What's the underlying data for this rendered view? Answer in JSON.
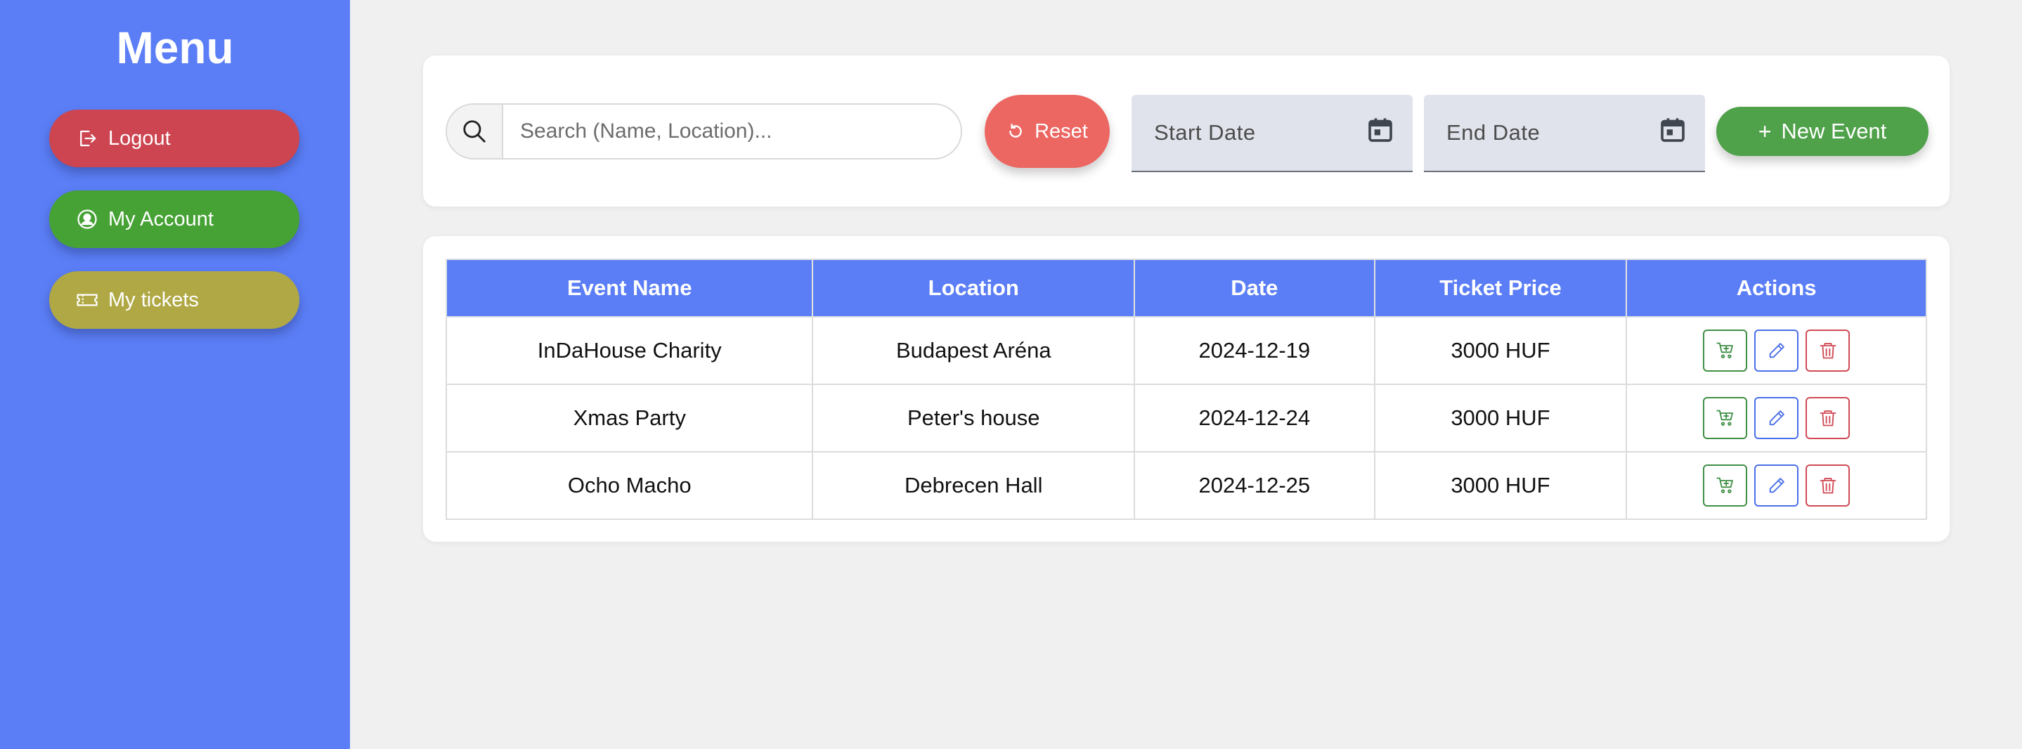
{
  "sidebar": {
    "title": "Menu",
    "logout_label": "Logout",
    "account_label": "My Account",
    "tickets_label": "My tickets",
    "colors": {
      "background": "#5b7ef6",
      "logout": "#cc4550",
      "account": "#46a235",
      "tickets": "#b0a845"
    }
  },
  "filters": {
    "search_placeholder": "Search (Name, Location)...",
    "search_value": "",
    "reset_label": "Reset",
    "start_date_label": "Start Date",
    "end_date_label": "End Date",
    "new_event_label": "New Event",
    "colors": {
      "reset": "#ec6662",
      "new_event": "#4fa14a"
    }
  },
  "table": {
    "headers": [
      "Event Name",
      "Location",
      "Date",
      "Ticket Price",
      "Actions"
    ],
    "rows": [
      {
        "name": "InDaHouse Charity",
        "location": "Budapest Aréna",
        "date": "2024-12-19",
        "price": "3000 HUF"
      },
      {
        "name": "Xmas Party",
        "location": "Peter's house",
        "date": "2024-12-24",
        "price": "3000 HUF"
      },
      {
        "name": "Ocho Macho",
        "location": "Debrecen Hall",
        "date": "2024-12-25",
        "price": "3000 HUF"
      }
    ],
    "actions": [
      "cart-plus-icon",
      "pencil-icon",
      "trash-icon"
    ],
    "colors": {
      "header": "#5b7ef6",
      "cart": "#3f8f45",
      "edit": "#4a6fe8",
      "delete": "#d04a55"
    }
  }
}
